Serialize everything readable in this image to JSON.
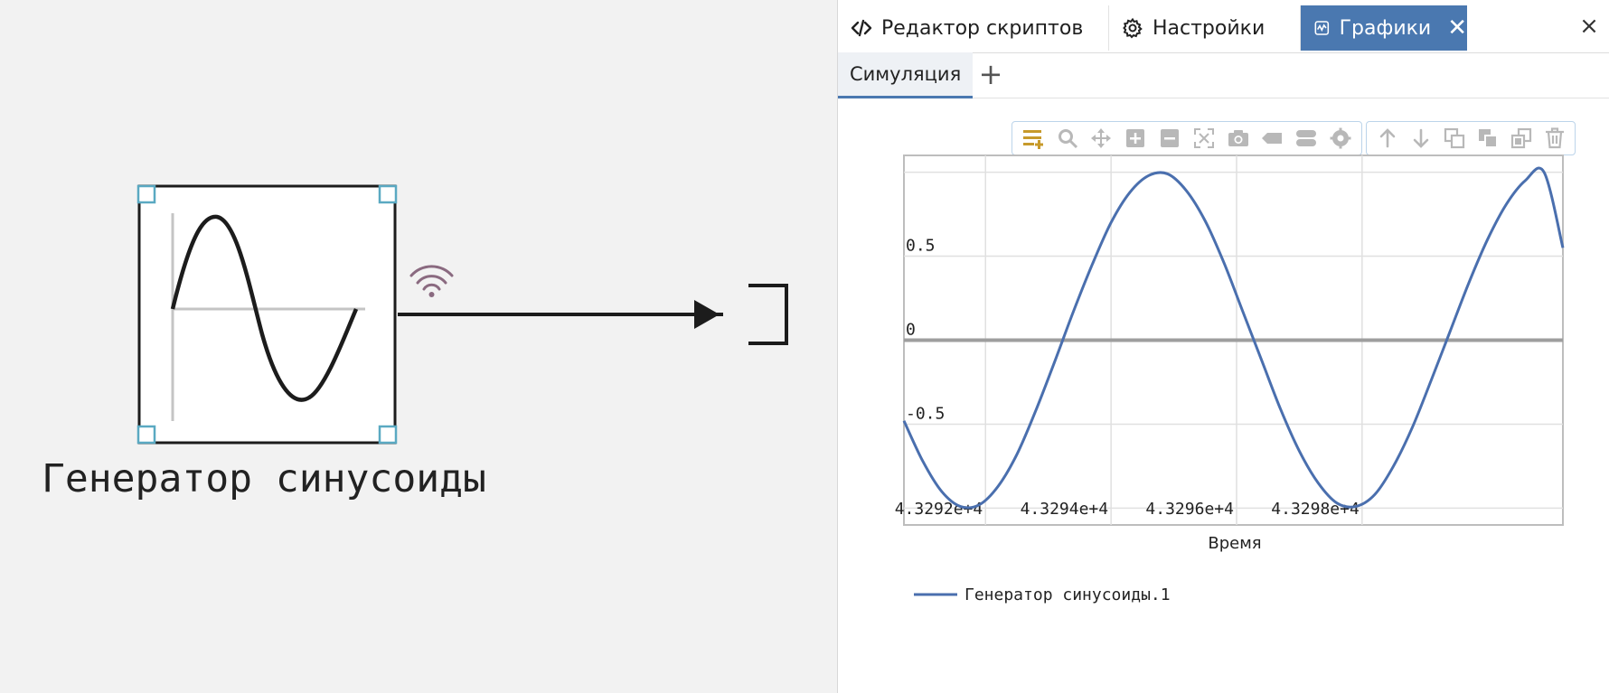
{
  "canvas": {
    "block": {
      "label": "Генератор синусоиды",
      "icon": "sine-wave-icon",
      "signal_icon": "wireless-signal-icon"
    }
  },
  "panel": {
    "tabs": [
      {
        "label": "Редактор скриптов",
        "icon": "code-icon",
        "active": false
      },
      {
        "label": "Настройки",
        "icon": "gear-icon",
        "active": false
      },
      {
        "label": "Графики",
        "icon": "chart-icon",
        "active": true
      }
    ],
    "close_glyph": "×",
    "tab_close_glyph": "✕",
    "subtabs": [
      {
        "label": "Симуляция",
        "active": true
      }
    ],
    "add_subtab_glyph": "+",
    "toolbar_left": [
      "add-series-icon",
      "zoom-icon",
      "pan-icon",
      "zoom-in-icon",
      "zoom-out-icon",
      "autoscale-icon",
      "camera-icon",
      "tag-icon",
      "toggle-icon",
      "settings-icon"
    ],
    "toolbar_right": [
      "arrow-up-icon",
      "arrow-down-icon",
      "copy-icon",
      "copy-filled-icon",
      "copy-outline-icon",
      "trash-icon"
    ],
    "accent": "#4a78b0",
    "series_color": "#4a6fae"
  },
  "chart_data": {
    "type": "line",
    "xlabel": "Время",
    "ylabel": "",
    "xlim": [
      43290.7,
      43301.2
    ],
    "ylim": [
      -1.1,
      1.1
    ],
    "yticks": [
      "0.5",
      "0",
      "-0.5"
    ],
    "ytick_values": [
      0.5,
      0,
      -0.5
    ],
    "xticks": [
      "4.3292e+4",
      "4.3294e+4",
      "4.3296e+4",
      "4.3298e+4"
    ],
    "xtick_values": [
      43292,
      43294,
      43296,
      43298
    ],
    "grid": true,
    "legend_position": "bottom-left",
    "series": [
      {
        "name": "Генератор синусоиды.1",
        "function": "sin(2*pi*x/6.283)",
        "x": [
          43290.7,
          43291.0,
          43291.3,
          43291.6,
          43291.9,
          43292.2,
          43292.5,
          43292.8,
          43293.1,
          43293.4,
          43293.7,
          43294.0,
          43294.3,
          43294.6,
          43294.9,
          43295.2,
          43295.5,
          43295.8,
          43296.1,
          43296.4,
          43296.7,
          43297.0,
          43297.3,
          43297.6,
          43297.9,
          43298.2,
          43298.5,
          43298.8,
          43299.1,
          43299.4,
          43299.7,
          43300.0,
          43300.3,
          43300.6,
          43300.9,
          43301.2
        ],
        "values": [
          -0.48,
          -0.72,
          -0.9,
          -0.99,
          -0.98,
          -0.87,
          -0.68,
          -0.42,
          -0.13,
          0.17,
          0.45,
          0.7,
          0.88,
          0.98,
          0.99,
          0.89,
          0.71,
          0.46,
          0.17,
          -0.12,
          -0.41,
          -0.66,
          -0.85,
          -0.97,
          -0.99,
          -0.92,
          -0.75,
          -0.52,
          -0.24,
          0.05,
          0.34,
          0.6,
          0.81,
          0.95,
          1.0,
          0.55
        ]
      }
    ]
  }
}
